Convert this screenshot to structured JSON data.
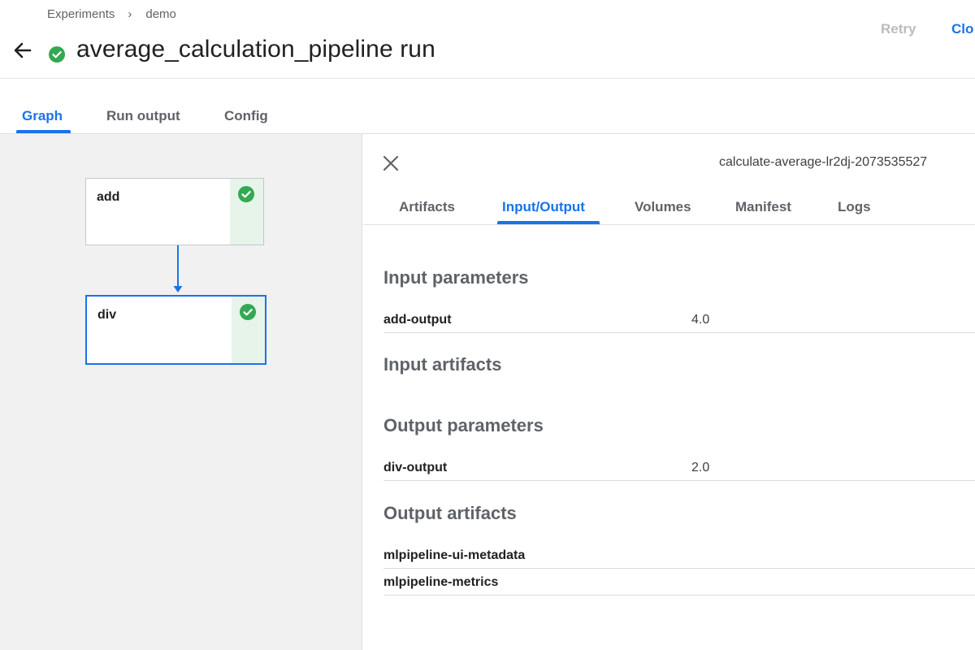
{
  "breadcrumb": {
    "items": [
      "Experiments",
      "demo"
    ],
    "separator": "›"
  },
  "header": {
    "title": "average_calculation_pipeline run",
    "status": "succeeded",
    "retry_label": "Retry",
    "clone_label": "Clo"
  },
  "main_tabs": [
    {
      "label": "Graph",
      "active": true
    },
    {
      "label": "Run output",
      "active": false
    },
    {
      "label": "Config",
      "active": false
    }
  ],
  "graph": {
    "nodes": [
      {
        "label": "add",
        "status": "succeeded",
        "selected": false
      },
      {
        "label": "div",
        "status": "succeeded",
        "selected": true
      }
    ]
  },
  "side_panel": {
    "node_id": "calculate-average-lr2dj-2073535527",
    "tabs": [
      {
        "label": "Artifacts",
        "active": false
      },
      {
        "label": "Input/Output",
        "active": true
      },
      {
        "label": "Volumes",
        "active": false
      },
      {
        "label": "Manifest",
        "active": false
      },
      {
        "label": "Logs",
        "active": false
      }
    ],
    "sections": {
      "input_parameters": {
        "title": "Input parameters",
        "rows": [
          {
            "key": "add-output",
            "value": "4.0"
          }
        ]
      },
      "input_artifacts": {
        "title": "Input artifacts",
        "rows": []
      },
      "output_parameters": {
        "title": "Output parameters",
        "rows": [
          {
            "key": "div-output",
            "value": "2.0"
          }
        ]
      },
      "output_artifacts": {
        "title": "Output artifacts",
        "rows": [
          {
            "key": "mlpipeline-ui-metadata",
            "value": ""
          },
          {
            "key": "mlpipeline-metrics",
            "value": ""
          }
        ]
      }
    }
  },
  "colors": {
    "accent": "#1a73e8",
    "success": "#34a853",
    "success_bg": "#e6f4ea",
    "graph_bg": "#f1f1f1",
    "disabled": "#b8bcc0"
  }
}
